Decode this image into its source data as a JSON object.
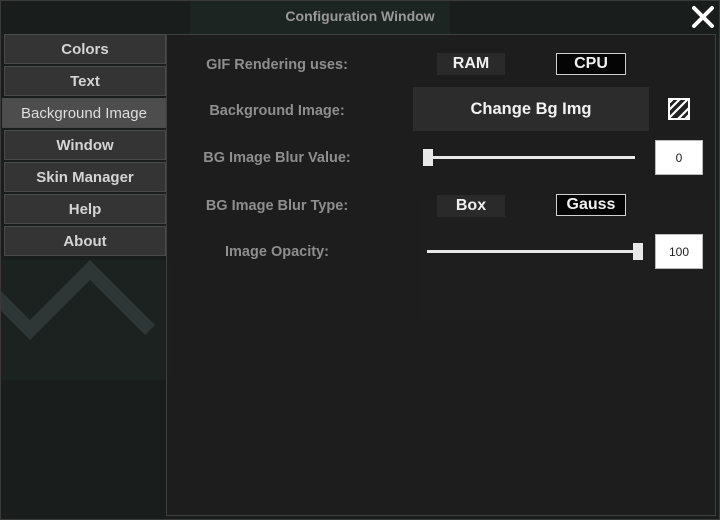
{
  "window": {
    "title": "Configuration Window"
  },
  "sidebar": {
    "items": [
      {
        "label": "Colors"
      },
      {
        "label": "Text"
      },
      {
        "label": "Background Image",
        "active": true
      },
      {
        "label": "Window"
      },
      {
        "label": "Skin Manager"
      },
      {
        "label": "Help"
      },
      {
        "label": "About"
      }
    ]
  },
  "settings": {
    "gif_rendering": {
      "label": "GIF Rendering uses:",
      "options": [
        "RAM",
        "CPU"
      ],
      "selected": "CPU"
    },
    "background_image": {
      "label": "Background Image:",
      "button": "Change Bg Img"
    },
    "blur_value": {
      "label": "BG Image Blur Value:",
      "value": "0",
      "fraction": 0.0
    },
    "blur_type": {
      "label": "BG Image Blur Type:",
      "options": [
        "Box",
        "Gauss"
      ],
      "selected": "Gauss"
    },
    "opacity": {
      "label": "Image Opacity:",
      "value": "100",
      "fraction": 1.0
    }
  },
  "icons": {
    "close": "close-icon",
    "pattern": "pattern-icon"
  }
}
